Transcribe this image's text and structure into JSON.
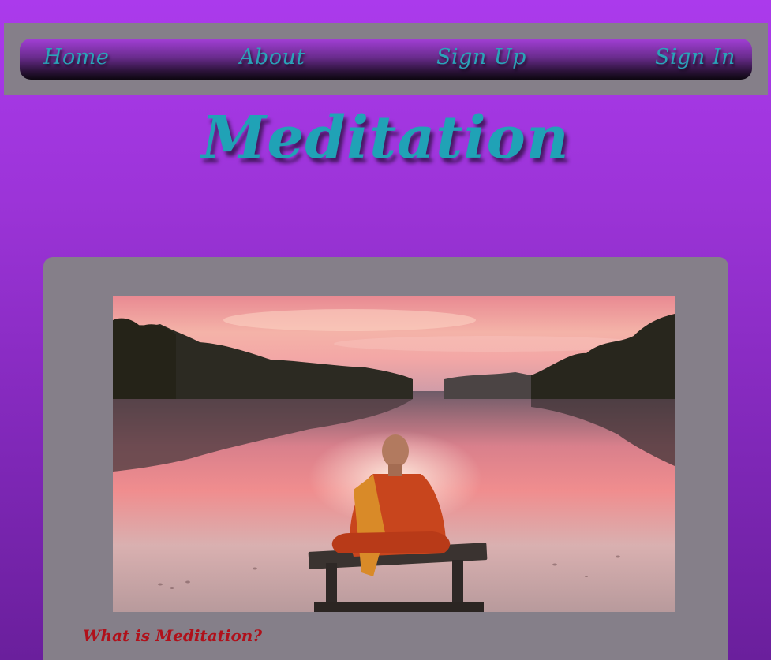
{
  "nav": {
    "items": [
      {
        "label": "Home"
      },
      {
        "label": "About"
      },
      {
        "label": "Sign Up"
      },
      {
        "label": "Sign In"
      }
    ]
  },
  "header": {
    "title": "Meditation"
  },
  "main": {
    "hero_image": "monk-meditating-by-lake-at-sunset",
    "section_heading": "What is Meditation?"
  },
  "colors": {
    "page_background_top": "#ab3aec",
    "page_background_bottom": "#6a1f9c",
    "panel_gray": "#857f89",
    "link_teal": "#2aa3b8",
    "heading_red": "#b0101a"
  }
}
